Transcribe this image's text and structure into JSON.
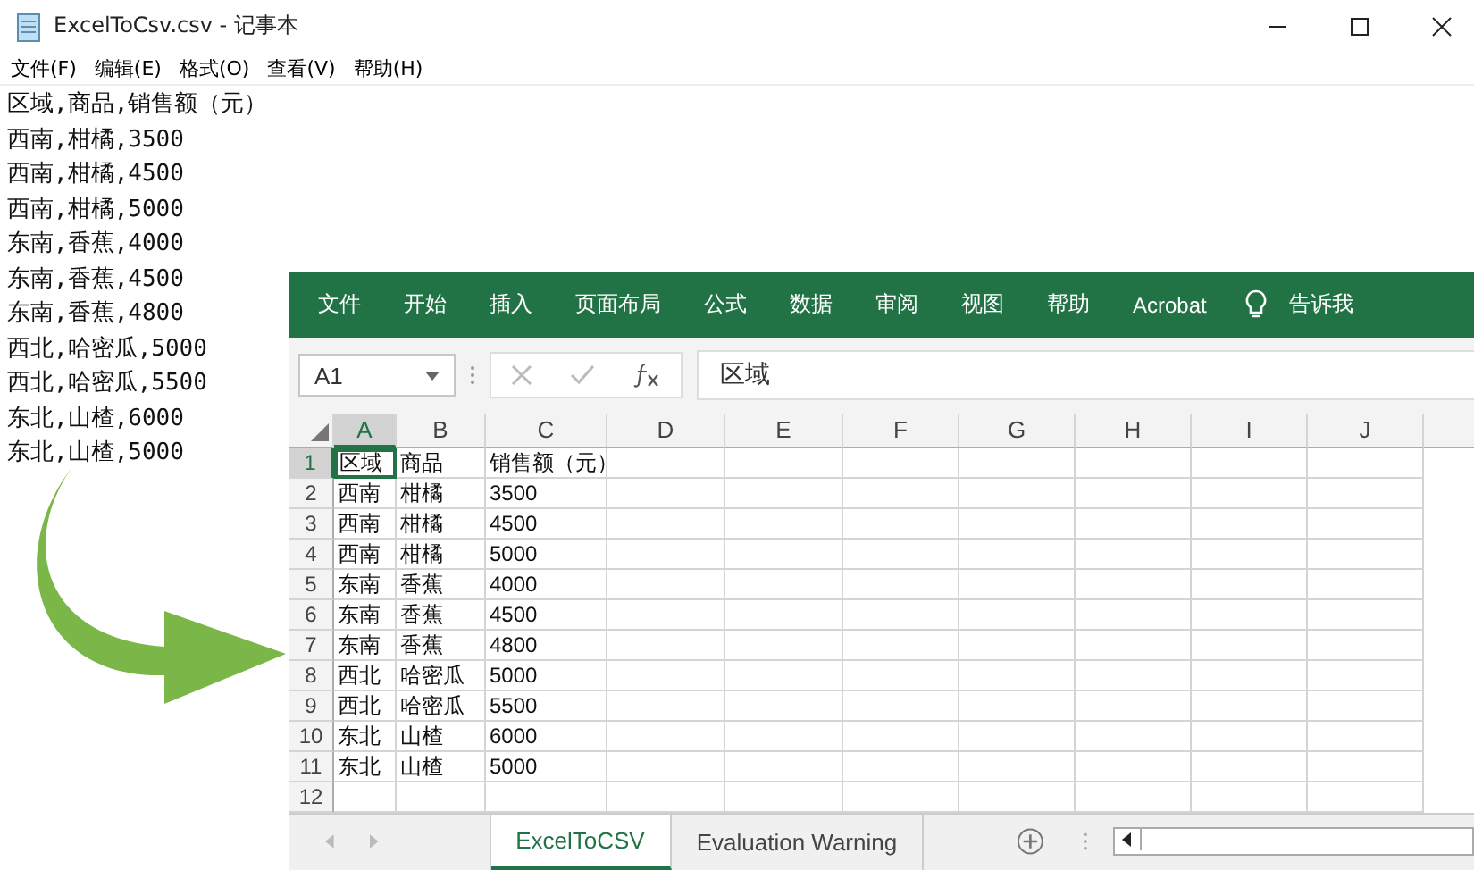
{
  "notepad": {
    "title": "ExcelToCsv.csv - 记事本",
    "menu": [
      "文件(F)",
      "编辑(E)",
      "格式(O)",
      "查看(V)",
      "帮助(H)"
    ],
    "lines": [
      "区域,商品,销售额（元）",
      "西南,柑橘,3500",
      "西南,柑橘,4500",
      "西南,柑橘,5000",
      "东南,香蕉,4000",
      "东南,香蕉,4500",
      "东南,香蕉,4800",
      "西北,哈密瓜,5000",
      "西北,哈密瓜,5500",
      "东北,山楂,6000",
      "东北,山楂,5000"
    ]
  },
  "excel": {
    "ribbon_tabs": [
      "文件",
      "开始",
      "插入",
      "页面布局",
      "公式",
      "数据",
      "审阅",
      "视图",
      "帮助",
      "Acrobat"
    ],
    "tell_me": "告诉我",
    "name_box": "A1",
    "formula_value": "区域",
    "columns": [
      {
        "label": "A",
        "selected": true
      },
      {
        "label": "B",
        "selected": false
      },
      {
        "label": "C",
        "selected": false
      },
      {
        "label": "D",
        "selected": false
      },
      {
        "label": "E",
        "selected": false
      },
      {
        "label": "F",
        "selected": false
      },
      {
        "label": "G",
        "selected": false
      },
      {
        "label": "H",
        "selected": false
      },
      {
        "label": "I",
        "selected": false
      },
      {
        "label": "J",
        "selected": false
      }
    ],
    "rows": [
      {
        "number": "1",
        "selected": true,
        "cells": [
          "区域",
          "商品",
          "销售额（元）"
        ]
      },
      {
        "number": "2",
        "selected": false,
        "cells": [
          "西南",
          "柑橘",
          "3500"
        ]
      },
      {
        "number": "3",
        "selected": false,
        "cells": [
          "西南",
          "柑橘",
          "4500"
        ]
      },
      {
        "number": "4",
        "selected": false,
        "cells": [
          "西南",
          "柑橘",
          "5000"
        ]
      },
      {
        "number": "5",
        "selected": false,
        "cells": [
          "东南",
          "香蕉",
          "4000"
        ]
      },
      {
        "number": "6",
        "selected": false,
        "cells": [
          "东南",
          "香蕉",
          "4500"
        ]
      },
      {
        "number": "7",
        "selected": false,
        "cells": [
          "东南",
          "香蕉",
          "4800"
        ]
      },
      {
        "number": "8",
        "selected": false,
        "cells": [
          "西北",
          "哈密瓜",
          "5000"
        ]
      },
      {
        "number": "9",
        "selected": false,
        "cells": [
          "西北",
          "哈密瓜",
          "5500"
        ]
      },
      {
        "number": "10",
        "selected": false,
        "cells": [
          "东北",
          "山楂",
          "6000"
        ]
      },
      {
        "number": "11",
        "selected": false,
        "cells": [
          "东北",
          "山楂",
          "5000"
        ]
      },
      {
        "number": "12",
        "selected": false,
        "cells": []
      }
    ],
    "sheet_tabs": [
      {
        "label": "ExcelToCSV",
        "selected": true
      },
      {
        "label": "Evaluation Warning",
        "selected": false
      }
    ]
  }
}
